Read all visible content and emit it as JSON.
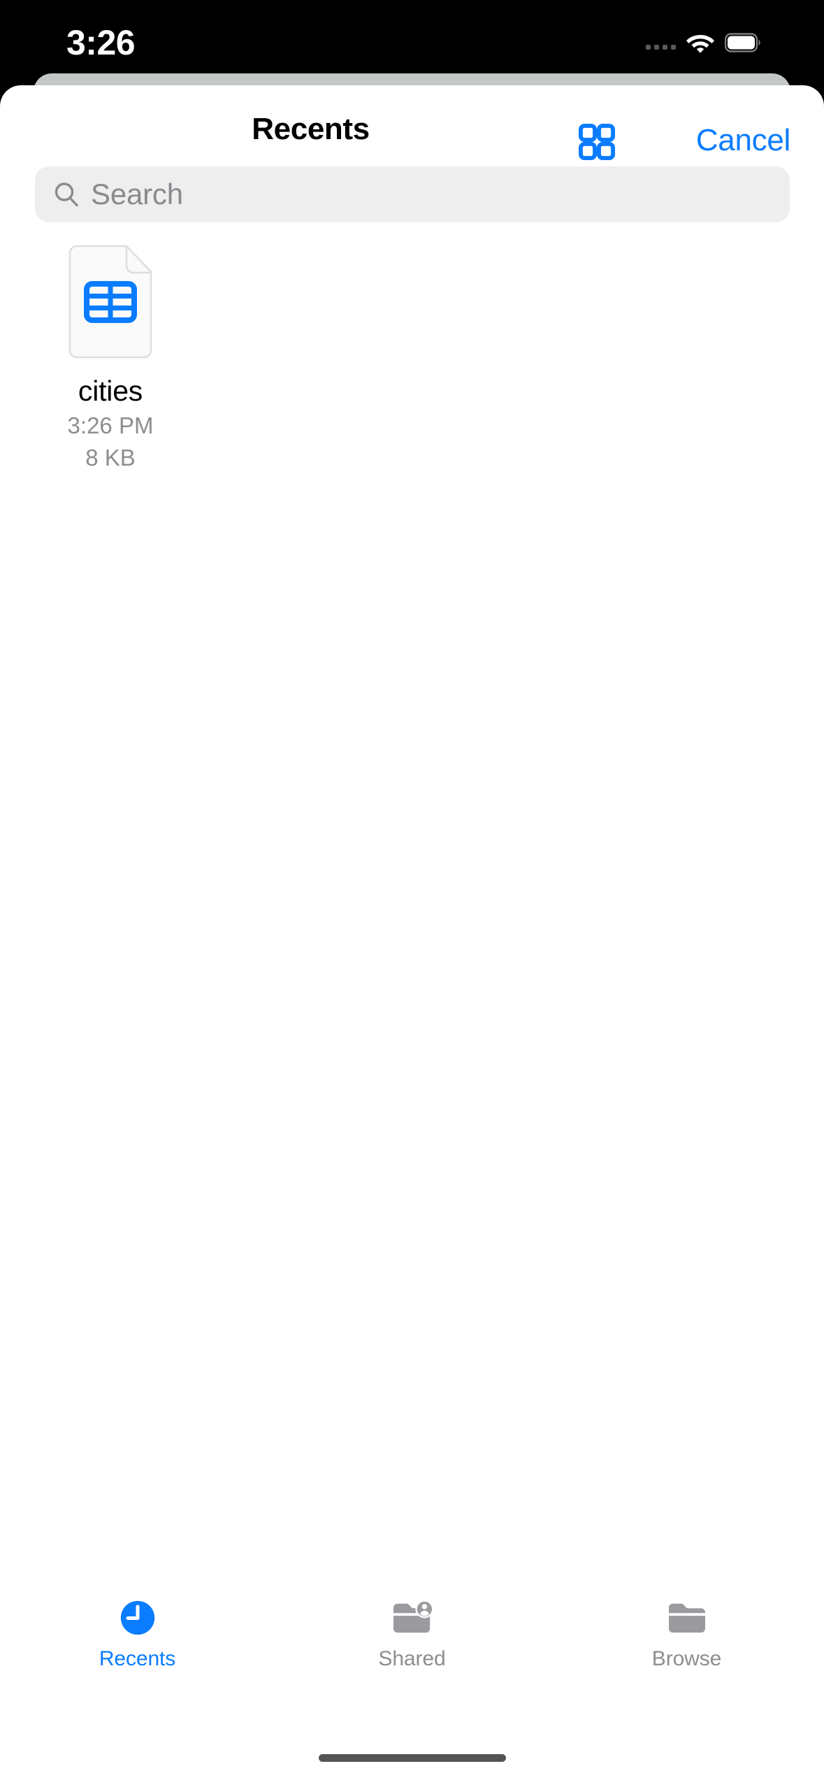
{
  "status_bar": {
    "time": "3:26",
    "icons": [
      "cellular-dots-icon",
      "wifi-icon",
      "battery-icon"
    ]
  },
  "nav_bar": {
    "title": "Recents",
    "grid_view_icon": "grid-2x2-icon",
    "cancel_label": "Cancel"
  },
  "search": {
    "placeholder": "Search",
    "value": "",
    "icon": "search-icon"
  },
  "files": [
    {
      "name": "cities",
      "time": "3:26 PM",
      "size": "8 KB",
      "icon": "csv-table-document-icon"
    }
  ],
  "tab_bar": {
    "items": [
      {
        "label": "Recents",
        "icon": "clock-fill-icon",
        "active": true
      },
      {
        "label": "Shared",
        "icon": "folder-person-icon",
        "active": false
      },
      {
        "label": "Browse",
        "icon": "folder-icon",
        "active": false
      }
    ]
  },
  "colors": {
    "accent": "#0a7cff",
    "file_glyph": "#0a7cff",
    "secondary_text": "#8d8d92",
    "search_bg": "#eeeeef",
    "sheet_bg": "#ffffff",
    "backdrop_card": "#c4c7c8",
    "status_bg": "#000000"
  }
}
